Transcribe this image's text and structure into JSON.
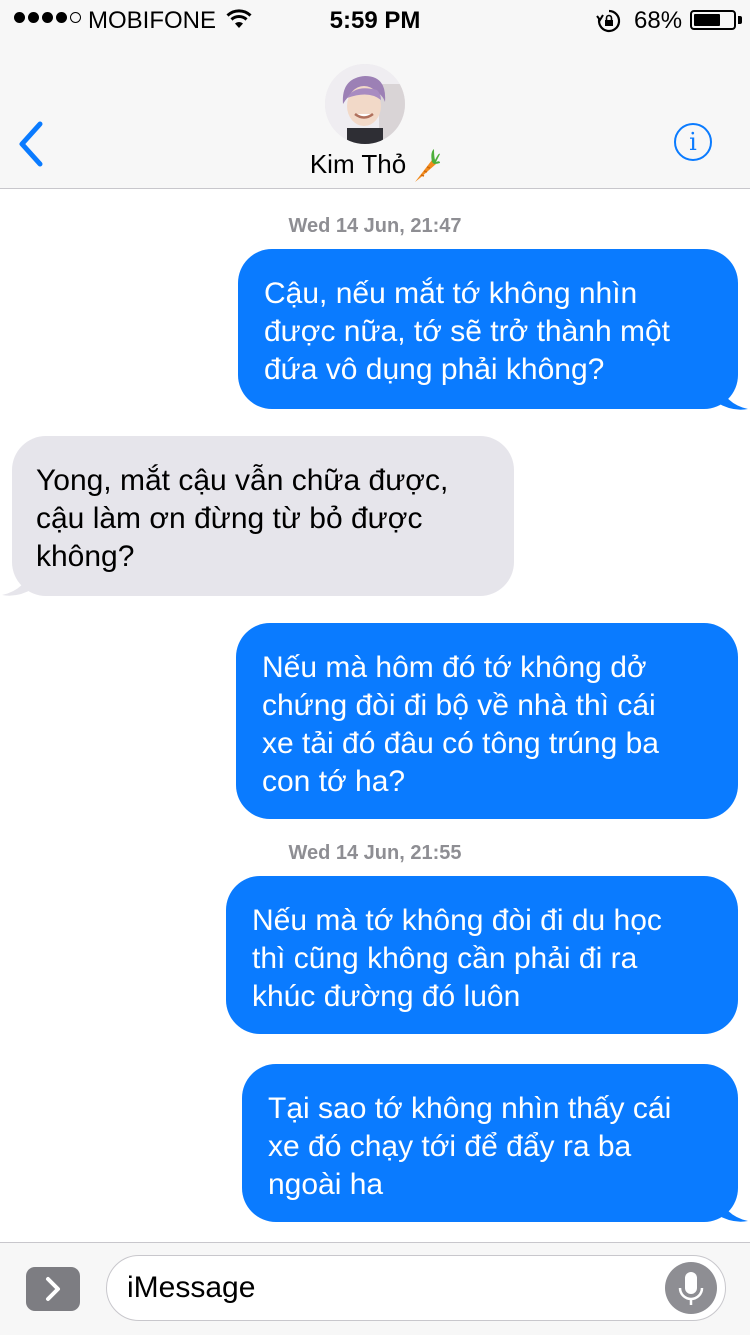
{
  "status_bar": {
    "carrier": "MOBIFONE",
    "time": "5:59 PM",
    "battery_percent_label": "68%",
    "battery_level": 0.68,
    "signal_bars_filled": 4,
    "signal_bars_total": 5
  },
  "header": {
    "contact_name": "Kim Thỏ",
    "contact_emoji_icon": "carrot-icon",
    "back_icon": "chevron-left-icon",
    "info_icon": "info-icon",
    "info_glyph": "i"
  },
  "conversation": {
    "timestamps": [
      "Wed 14 Jun, 21:47",
      "Wed 14 Jun, 21:55"
    ],
    "messages": [
      {
        "direction": "outgoing",
        "text_lines": [
          "Cậu, nếu mắt tớ không nhìn",
          "được nữa, tớ sẽ trở thành một",
          "đứa vô dụng phải không?"
        ]
      },
      {
        "direction": "incoming",
        "text_lines": [
          "Yong, mắt cậu vẫn chữa được,",
          "cậu làm ơn đừng từ bỏ được",
          "không?"
        ]
      },
      {
        "direction": "outgoing",
        "text_lines": [
          "Nếu mà hôm đó tớ không dở",
          "chứng đòi đi bộ về nhà thì cái",
          "xe tải đó đâu có tông trúng ba",
          "con tớ ha?"
        ]
      },
      {
        "direction": "outgoing",
        "text_lines": [
          "Nếu mà tớ không đòi đi du học",
          "thì cũng không cần phải đi ra",
          "khúc đường đó luôn"
        ]
      },
      {
        "direction": "outgoing",
        "text_lines": [
          "Tại sao tớ không nhìn thấy cái",
          "xe đó chạy tới để đẩy ra ba",
          "ngoài ha"
        ]
      }
    ]
  },
  "input_bar": {
    "placeholder": "iMessage",
    "apps_icon": "chevron-right-icon",
    "mic_icon": "microphone-icon"
  },
  "colors": {
    "outgoing_bubble": "#0a7bff",
    "incoming_bubble": "#e6e5eb",
    "accent": "#0a7bff"
  }
}
